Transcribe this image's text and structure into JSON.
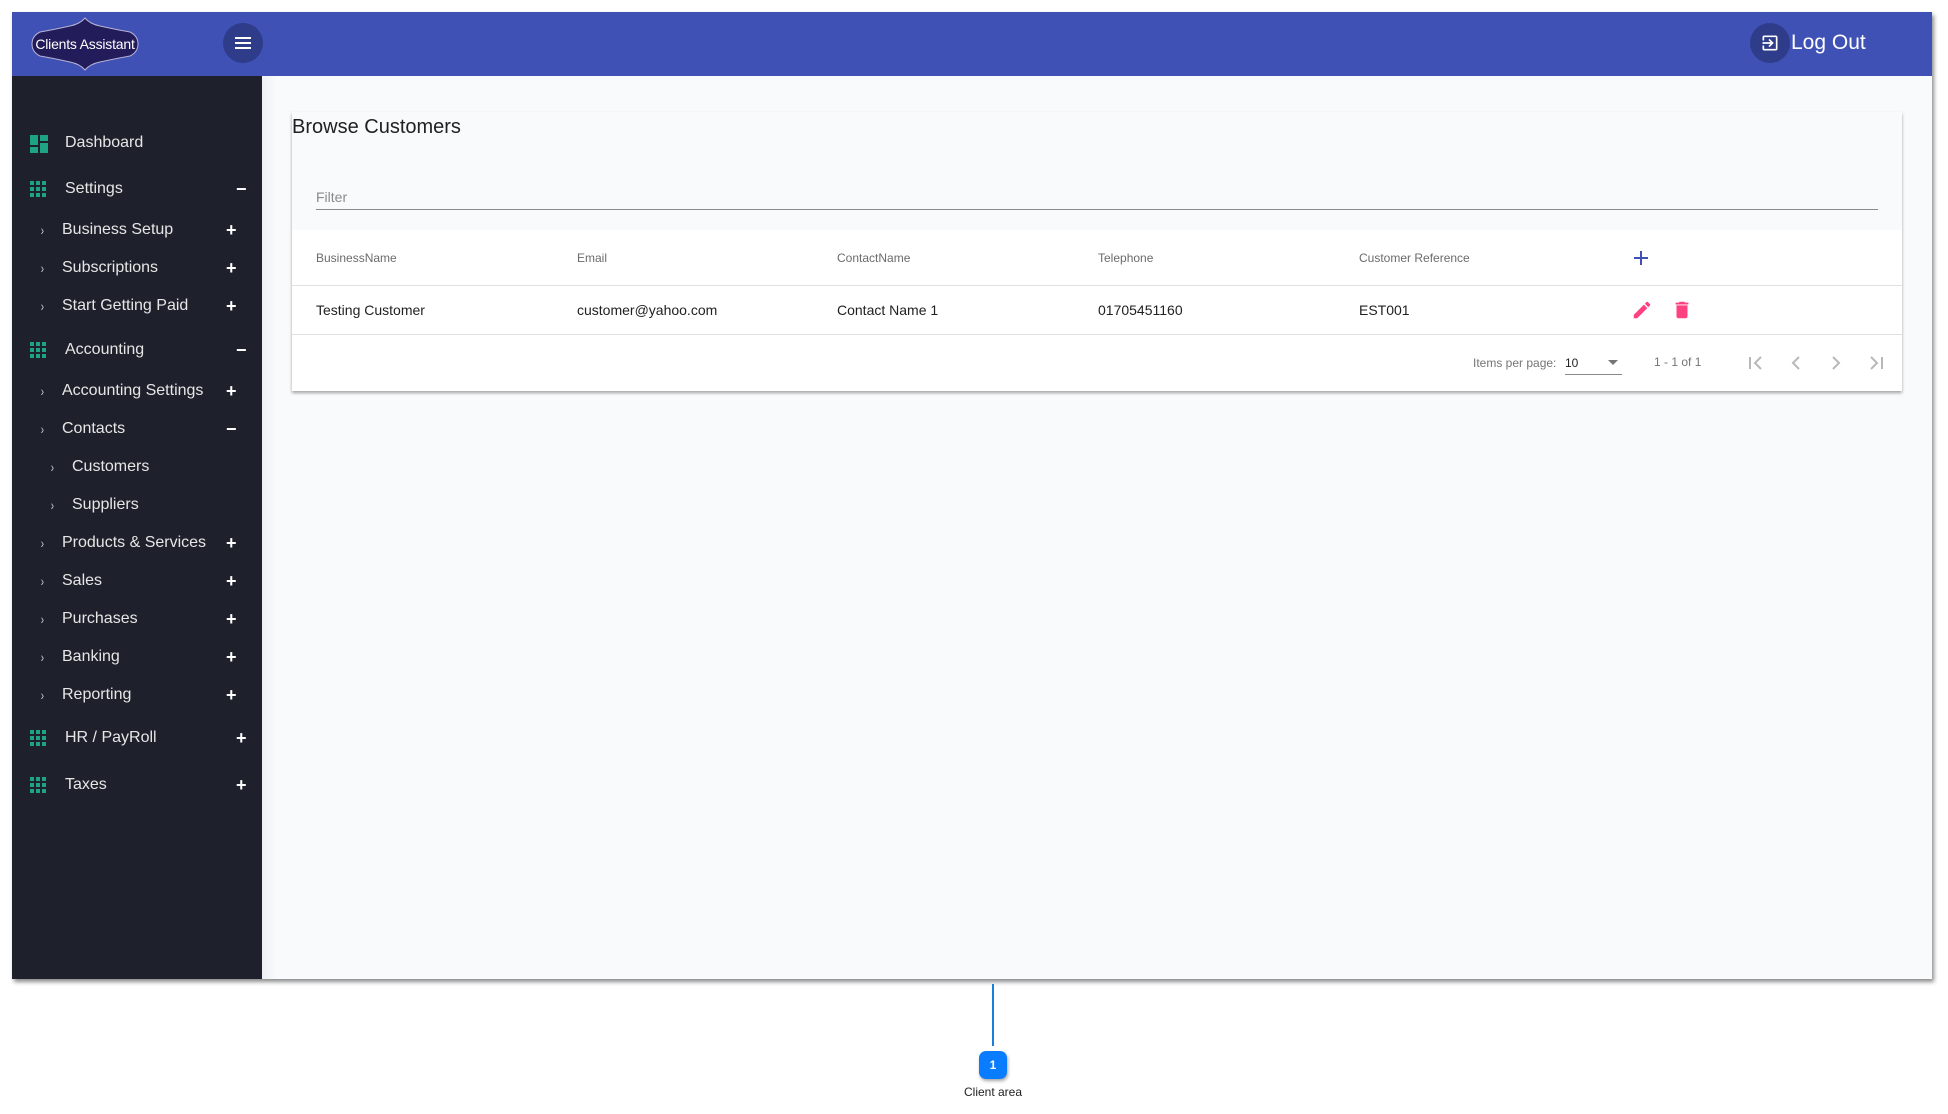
{
  "app": {
    "logo_text": "Clients Assistant",
    "logout_label": "Log Out",
    "colors": {
      "header": "#3f51b5",
      "sidebar": "#1e212b",
      "accent_green": "#1fa385",
      "action_pink": "#ff4081",
      "add_blue": "#3f51b5"
    }
  },
  "sidebar": {
    "items": [
      {
        "label": "Dashboard",
        "level": 0,
        "icon": "dashboard-icon",
        "toggle": ""
      },
      {
        "label": "Settings",
        "level": 0,
        "icon": "apps-grid-icon",
        "toggle": "−"
      },
      {
        "label": "Business Setup",
        "level": 1,
        "toggle": "+"
      },
      {
        "label": "Subscriptions",
        "level": 1,
        "toggle": "+"
      },
      {
        "label": "Start Getting Paid",
        "level": 1,
        "toggle": "+"
      },
      {
        "label": "Accounting",
        "level": 0,
        "icon": "apps-grid-icon",
        "toggle": "−"
      },
      {
        "label": "Accounting Settings",
        "level": 1,
        "toggle": "+"
      },
      {
        "label": "Contacts",
        "level": 1,
        "toggle": "−"
      },
      {
        "label": "Customers",
        "level": 2,
        "toggle": ""
      },
      {
        "label": "Suppliers",
        "level": 2,
        "toggle": ""
      },
      {
        "label": "Products & Services",
        "level": 1,
        "toggle": "+"
      },
      {
        "label": "Sales",
        "level": 1,
        "toggle": "+"
      },
      {
        "label": "Purchases",
        "level": 1,
        "toggle": "+"
      },
      {
        "label": "Banking",
        "level": 1,
        "toggle": "+"
      },
      {
        "label": "Reporting",
        "level": 1,
        "toggle": "+"
      },
      {
        "label": "HR / PayRoll",
        "level": 0,
        "icon": "apps-grid-icon",
        "toggle": "+"
      },
      {
        "label": "Taxes",
        "level": 0,
        "icon": "apps-grid-icon",
        "toggle": "+"
      }
    ]
  },
  "main": {
    "title": "Browse Customers",
    "filter": {
      "placeholder": "Filter",
      "value": ""
    },
    "table": {
      "columns": [
        "BusinessName",
        "Email",
        "ContactName",
        "Telephone",
        "Customer Reference"
      ],
      "rows": [
        [
          "Testing Customer",
          "customer@yahoo.com",
          "Contact Name 1",
          "01705451160",
          "EST001"
        ]
      ]
    },
    "paginator": {
      "items_per_page_label": "Items per page:",
      "items_per_page": "10",
      "range_label": "1 - 1 of 1"
    }
  },
  "annotation": {
    "number": "1",
    "label": "Client area"
  }
}
